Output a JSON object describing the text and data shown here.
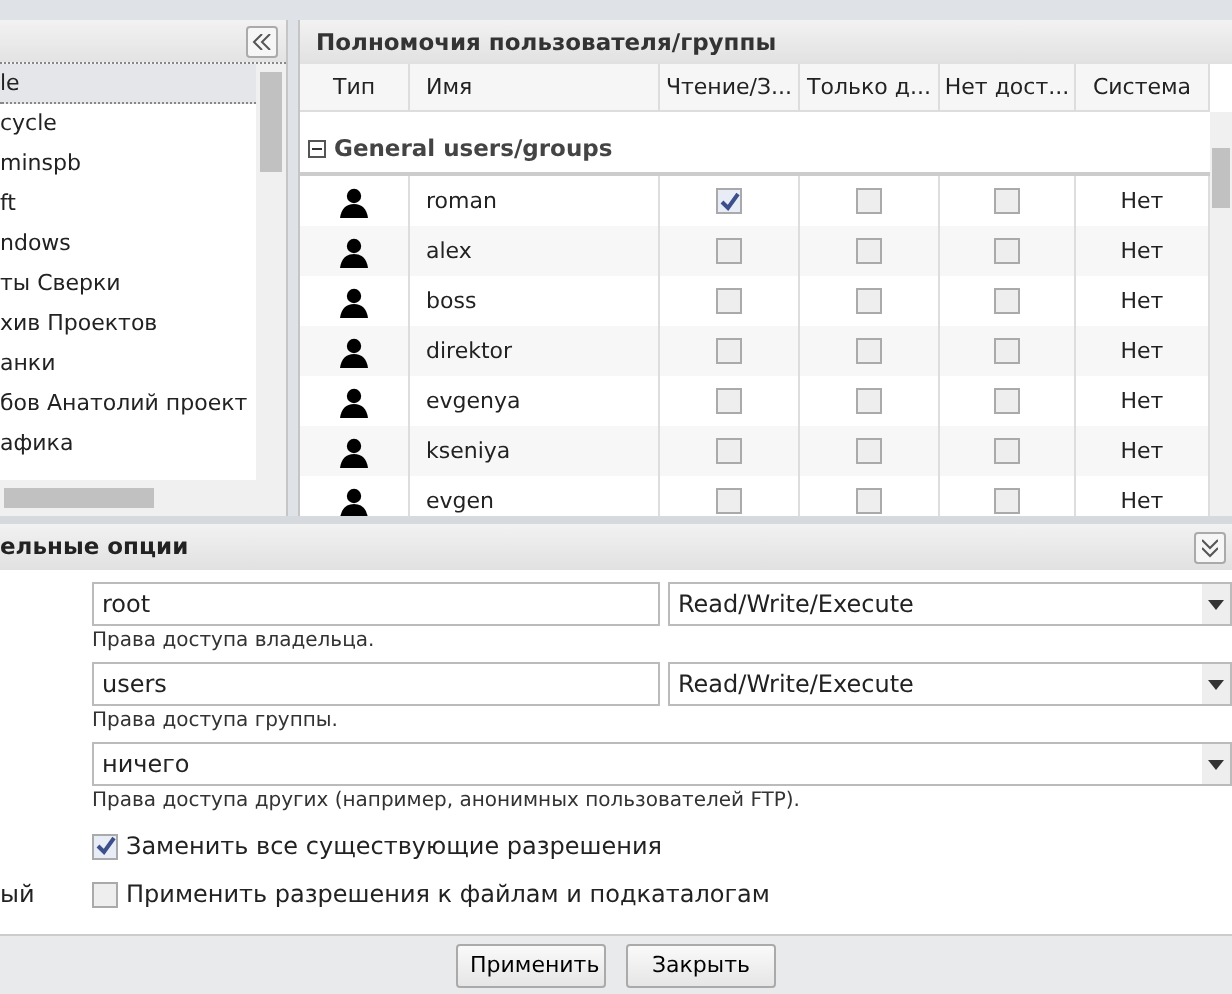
{
  "left_panel": {
    "items": [
      {
        "label": "le",
        "selected": true
      },
      {
        "label": "cycle",
        "selected": false
      },
      {
        "label": "minspb",
        "selected": false
      },
      {
        "label": "ft",
        "selected": false
      },
      {
        "label": "ndows",
        "selected": false
      },
      {
        "label": "ты Сверки",
        "selected": false
      },
      {
        "label": "хив Проектов",
        "selected": false
      },
      {
        "label": "анки",
        "selected": false
      },
      {
        "label": "бов Анатолий проект",
        "selected": false
      },
      {
        "label": "афика",
        "selected": false
      }
    ]
  },
  "permissions": {
    "title": "Полномочия пользователя/группы",
    "columns": [
      "Тип",
      "Имя",
      "Чтение/З...",
      "Только д...",
      "Нет дост...",
      "Система"
    ],
    "group": {
      "label": "General users/groups",
      "expanded": true
    },
    "rows": [
      {
        "name": "roman",
        "read_write": true,
        "read_only": false,
        "no_access": false,
        "system": "Нет"
      },
      {
        "name": "alex",
        "read_write": false,
        "read_only": false,
        "no_access": false,
        "system": "Нет"
      },
      {
        "name": "boss",
        "read_write": false,
        "read_only": false,
        "no_access": false,
        "system": "Нет"
      },
      {
        "name": "direktor",
        "read_write": false,
        "read_only": false,
        "no_access": false,
        "system": "Нет"
      },
      {
        "name": "evgenya",
        "read_write": false,
        "read_only": false,
        "no_access": false,
        "system": "Нет"
      },
      {
        "name": "kseniya",
        "read_write": false,
        "read_only": false,
        "no_access": false,
        "system": "Нет"
      },
      {
        "name": "evgen",
        "read_write": false,
        "read_only": false,
        "no_access": false,
        "system": "Нет"
      }
    ]
  },
  "options": {
    "title": "ельные опции",
    "owner": {
      "value": "root",
      "mode": "Read/Write/Execute",
      "hint": "Права доступа владельца."
    },
    "group": {
      "value": "users",
      "mode": "Read/Write/Execute",
      "hint": "Права доступа группы."
    },
    "others": {
      "mode": "ничего",
      "hint": "Права доступа других (например, анонимных пользователей FTP)."
    },
    "replace": {
      "label": "Заменить все существующие разрешения",
      "checked": true
    },
    "recursive": {
      "side_label": "ый",
      "label": "Применить разрешения к файлам и подкаталогам",
      "checked": false
    }
  },
  "buttons": [
    "Применить",
    "Закрыть"
  ]
}
